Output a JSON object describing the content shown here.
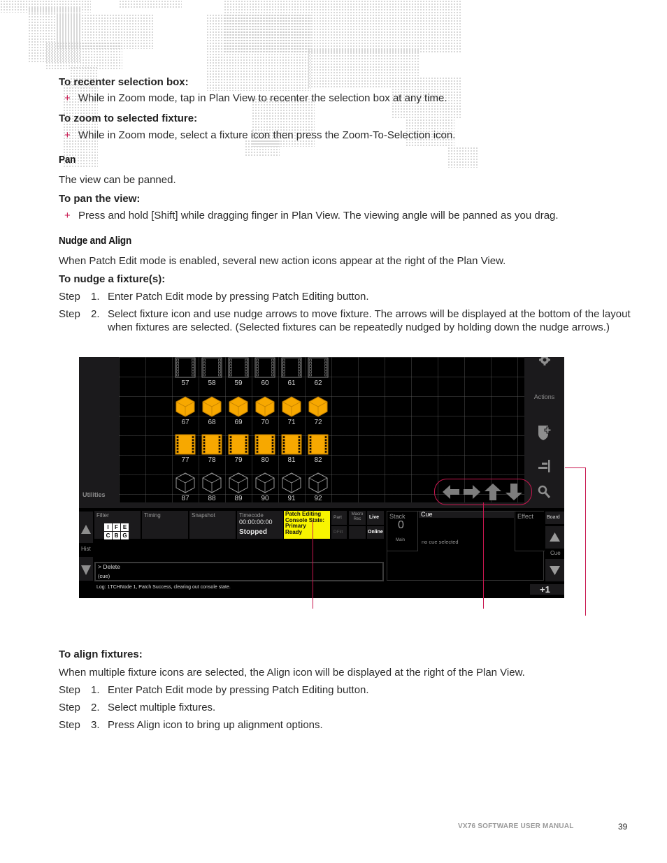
{
  "sections": {
    "recenter_heading": "To recenter selection box:",
    "recenter_bullet": "While in Zoom mode, tap in Plan View to recenter the selection box at any time.",
    "zoom_heading": "To zoom to selected fixture:",
    "zoom_bullet": "While in Zoom mode, select a fixture icon then press the Zoom-To-Selection icon.",
    "pan_title": "Pan",
    "pan_text": "The view can be panned.",
    "pan_heading": "To pan the view:",
    "pan_bullet": "Press and hold [Shift] while dragging finger in Plan View. The viewing angle will be panned as you drag.",
    "nudge_title": "Nudge and Align",
    "nudge_text": "When Patch Edit mode is enabled, several new action icons appear at the right of the Plan View.",
    "nudge_heading": "To nudge a fixture(s):",
    "nudge_steps": [
      {
        "word": "Step",
        "num": "1.",
        "text": "Enter Patch Edit mode by pressing Patch Editing button."
      },
      {
        "word": "Step",
        "num": "2.",
        "text": "Select fixture icon and use nudge arrows to move fixture. The arrows will be displayed at the bottom of the layout when fixtures are selected. (Selected fixtures can be repeatedly nudged by holding down the nudge arrows.)"
      }
    ],
    "align_heading": "To align fixtures:",
    "align_text": "When multiple fixture icons are selected, the Align icon will be displayed at the right of the Plan View.",
    "align_steps": [
      {
        "word": "Step",
        "num": "1.",
        "text": "Enter Patch Edit mode by pressing Patch Editing button."
      },
      {
        "word": "Step",
        "num": "2.",
        "text": "Select multiple fixtures."
      },
      {
        "word": "Step",
        "num": "3.",
        "text": "Press Align icon to bring up alignment options."
      }
    ],
    "bullet_glyph": "+"
  },
  "screenshot": {
    "utilities_label": "Utilities",
    "actions_label": "Actions",
    "fixture_rows": [
      {
        "type": "film-outline",
        "ids": [
          "57",
          "58",
          "59",
          "60",
          "61",
          "62"
        ]
      },
      {
        "type": "cube-selected",
        "ids": [
          "67",
          "68",
          "69",
          "70",
          "71",
          "72"
        ]
      },
      {
        "type": "film-selected",
        "ids": [
          "77",
          "78",
          "79",
          "80",
          "81",
          "82"
        ]
      },
      {
        "type": "cube-outline",
        "ids": [
          "87",
          "88",
          "89",
          "90",
          "91",
          "92"
        ]
      }
    ],
    "selected_color": "#f7a800",
    "bottom": {
      "filter": "Filter",
      "filter_letters": [
        "I",
        "F",
        "E",
        "C",
        "B",
        "G"
      ],
      "timing": "Timing",
      "snapshot": "Snapshot",
      "timecode_label": "Timecode",
      "timecode_value": "00:00:00:00",
      "stopped": "Stopped",
      "status_lines": [
        "Patch Editing",
        "Console State:",
        "Primary",
        "Ready"
      ],
      "part": "Part",
      "macro_rec": "Macro Rec",
      "live": "Live",
      "dfilt": "DFilt",
      "online": "Online",
      "hist": "Hist",
      "command_line": "> Delete",
      "command_sub": "(cue)",
      "log": "Log: 1TCHNode 1, Patch Success, clearing out console state.",
      "stack_label": "Stack",
      "stack_value": "0",
      "stack_name": "Main",
      "cue_label": "Cue",
      "cue_empty": "no cue selected",
      "effect_label": "Effect",
      "board": "Board",
      "cue_nav": "Cue",
      "plus_one": "+1"
    }
  },
  "footer": {
    "manual_title": "VX76 SOFTWARE USER MANUAL",
    "page_number": "39"
  },
  "colors": {
    "accent": "#c8174f",
    "highlight_yellow": "#f8f400"
  }
}
